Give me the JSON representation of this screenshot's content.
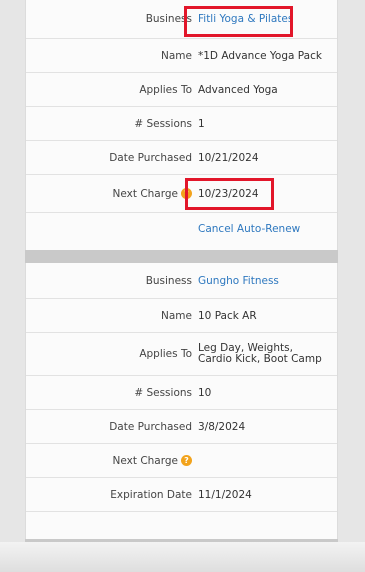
{
  "card1": {
    "rows": [
      {
        "label": "Business",
        "value": "Fitli Yoga & Pilates"
      },
      {
        "label": "Name",
        "value": "*1D Advance Yoga Pack"
      },
      {
        "label": "Applies To",
        "value": "Advanced Yoga"
      },
      {
        "label": "# Sessions",
        "value": "1"
      },
      {
        "label": "Date Purchased",
        "value": "10/21/2024"
      },
      {
        "label": "Next Charge",
        "value": "10/23/2024"
      },
      {
        "label": "",
        "value": "Cancel Auto-Renew"
      }
    ]
  },
  "card2": {
    "rows": [
      {
        "label": "Business",
        "value": "Gungho Fitness"
      },
      {
        "label": "Name",
        "value": "10 Pack AR"
      },
      {
        "label": "Applies To",
        "value": "Leg Day, Weights, Cardio Kick, Boot Camp"
      },
      {
        "label": "# Sessions",
        "value": "10"
      },
      {
        "label": "Date Purchased",
        "value": "3/8/2024"
      },
      {
        "label": "Next Charge",
        "value": ""
      },
      {
        "label": "Expiration Date",
        "value": "11/1/2024"
      }
    ]
  },
  "info_icon_glyph": "?",
  "colors": {
    "link": "#2e78bf",
    "highlight": "#e2162a",
    "info": "#f2a31c"
  }
}
